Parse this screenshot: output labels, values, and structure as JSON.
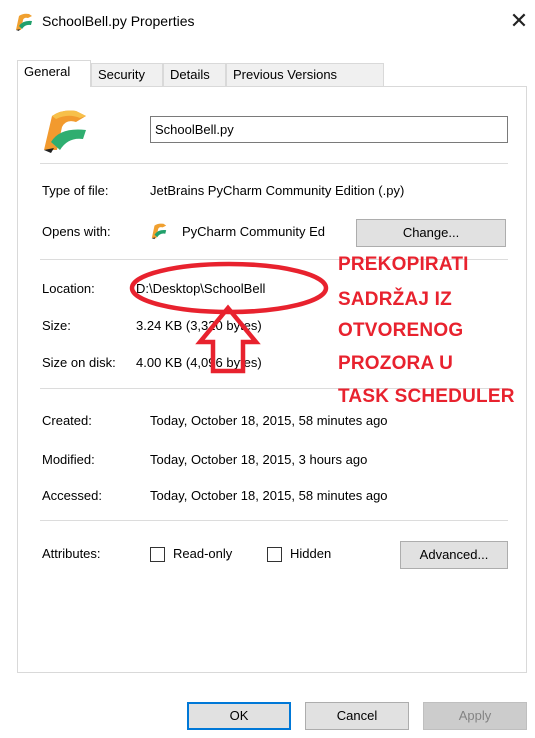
{
  "window": {
    "title": "SchoolBell.py Properties",
    "close_glyph": "✕"
  },
  "tabs": [
    {
      "label": "General",
      "active": true
    },
    {
      "label": "Security",
      "active": false
    },
    {
      "label": "Details",
      "active": false
    },
    {
      "label": "Previous Versions",
      "active": false
    }
  ],
  "file": {
    "name": "SchoolBell.py",
    "type_label": "Type of file:",
    "type_value": "JetBrains PyCharm Community Edition (.py)",
    "opens_label": "Opens with:",
    "opens_value": "PyCharm Community Ed",
    "change_button": "Change...",
    "location_label": "Location:",
    "location_value": "D:\\Desktop\\SchoolBell",
    "size_label": "Size:",
    "size_value": "3.24 KB (3,320 bytes)",
    "size_on_disk_label": "Size on disk:",
    "size_on_disk_value": "4.00 KB (4,096 bytes)",
    "created_label": "Created:",
    "created_value": "Today, October 18, 2015, 58 minutes ago",
    "modified_label": "Modified:",
    "modified_value": "Today, October 18, 2015, 3 hours ago",
    "accessed_label": "Accessed:",
    "accessed_value": "Today, October 18, 2015, 58 minutes ago",
    "attributes_label": "Attributes:",
    "readonly_label": "Read-only",
    "hidden_label": "Hidden",
    "advanced_button": "Advanced..."
  },
  "footer": {
    "ok": "OK",
    "cancel": "Cancel",
    "apply": "Apply"
  },
  "annotation": {
    "lines": [
      "PREKOPIRATI",
      "SADRŽAJ IZ",
      "OTVORENOG",
      "PROZORA U",
      "TASK SCHEDULER"
    ],
    "color": "#e8222e"
  },
  "colors": {
    "accent": "#0078d7",
    "pycharm_green": "#21d789",
    "pycharm_orange": "#fc801d"
  },
  "icons": {
    "app": "pycharm-icon",
    "close": "close-icon"
  }
}
